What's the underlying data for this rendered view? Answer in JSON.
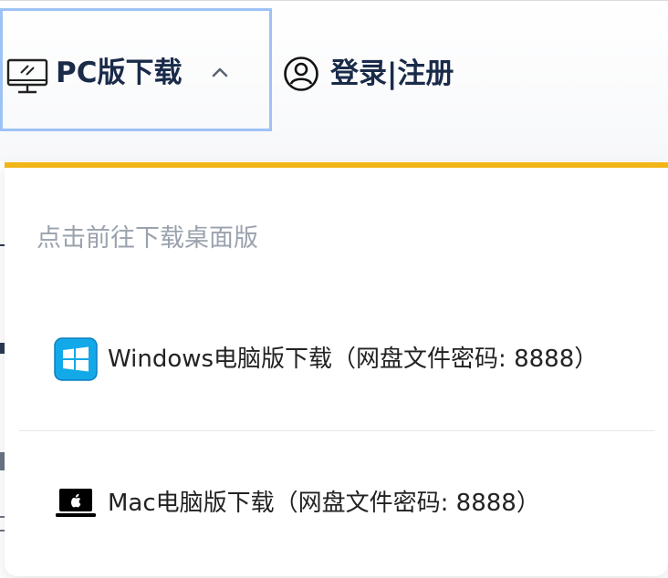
{
  "header": {
    "pc_download_label": "PC版下载",
    "login_label": "登录|注册",
    "icons": {
      "monitor": "monitor-icon",
      "chevron": "chevron-up-icon",
      "user": "user-circle-icon"
    }
  },
  "dropdown": {
    "hint": "点击前往下载桌面版",
    "items": [
      {
        "label": "Windows电脑版下载（网盘文件密码: 8888）",
        "icon": "windows-icon"
      },
      {
        "label": "Mac电脑版下载（网盘文件密码: 8888）",
        "icon": "apple-laptop-icon"
      }
    ]
  },
  "colors": {
    "accent_bar": "#f2b518",
    "focus_border": "#9ec2f5",
    "primary_text": "#1a2b4a",
    "hint_text": "#9aa2ad",
    "windows_blue": "#13a9e8"
  }
}
